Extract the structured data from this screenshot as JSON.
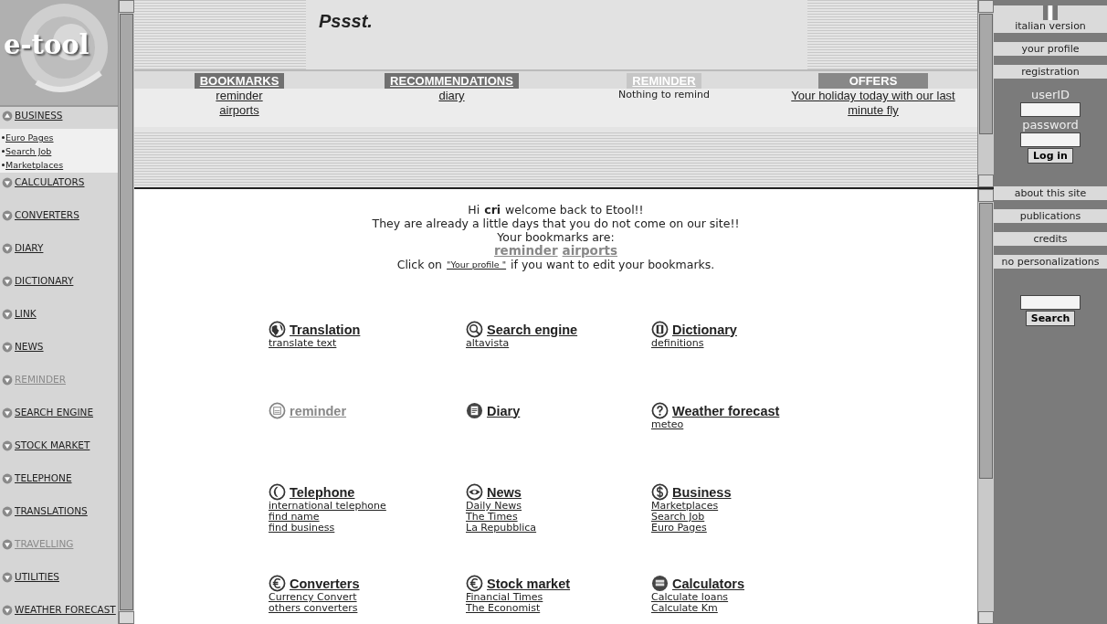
{
  "logo": {
    "text": "e-tool"
  },
  "sidebar": {
    "items": [
      {
        "label": "BUSINESS",
        "expanded": true,
        "disabled": false,
        "children": [
          {
            "label": "Euro Pages"
          },
          {
            "label": "Search Job"
          },
          {
            "label": "Marketplaces"
          }
        ]
      },
      {
        "label": "CALCULATORS",
        "expanded": false,
        "disabled": false
      },
      {
        "label": "CONVERTERS",
        "expanded": false,
        "disabled": false
      },
      {
        "label": "DIARY",
        "expanded": false,
        "disabled": false
      },
      {
        "label": "DICTIONARY",
        "expanded": false,
        "disabled": false
      },
      {
        "label": "LINK",
        "expanded": false,
        "disabled": false
      },
      {
        "label": "NEWS",
        "expanded": false,
        "disabled": false
      },
      {
        "label": "REMINDER",
        "expanded": false,
        "disabled": true
      },
      {
        "label": "SEARCH ENGINE",
        "expanded": false,
        "disabled": false
      },
      {
        "label": "STOCK MARKET",
        "expanded": false,
        "disabled": false
      },
      {
        "label": "TELEPHONE",
        "expanded": false,
        "disabled": false
      },
      {
        "label": "TRANSLATIONS",
        "expanded": false,
        "disabled": false
      },
      {
        "label": "TRAVELLING",
        "expanded": false,
        "disabled": true
      },
      {
        "label": "UTILITIES",
        "expanded": false,
        "disabled": false
      },
      {
        "label": "WEATHER FORECAST",
        "expanded": false,
        "disabled": false
      }
    ]
  },
  "banner": {
    "title": "Pssst."
  },
  "panels": [
    {
      "heading": "BOOKMARKS",
      "disabled": false,
      "links": [
        "reminder",
        "airports"
      ]
    },
    {
      "heading": "RECOMMENDATIONS",
      "disabled": false,
      "links": [
        "diary"
      ]
    },
    {
      "heading": "REMINDER",
      "disabled": true,
      "note": "Nothing to remind"
    },
    {
      "heading": "OFFERS",
      "disabled": false,
      "links": [
        "Your holiday today with our last minute fly"
      ]
    }
  ],
  "welcome": {
    "greeting": "Hi **cri** welcome back to Etool!!",
    "line_2": "They are already a little days that you do not come on our site!!",
    "line_3": "Your bookmarks are:",
    "bookmarks": [
      "reminder",
      "airports"
    ],
    "profile_prefix": "Click on",
    "profile_link": "\"Your profile \"",
    "profile_suffix": "if you want to edit your bookmarks."
  },
  "services": [
    {
      "title": "Translation",
      "disabled": false,
      "links": [
        "translate text"
      ]
    },
    {
      "title": "Search engine",
      "disabled": false,
      "links": [
        "altavista"
      ]
    },
    {
      "title": "Dictionary",
      "disabled": false,
      "links": [
        "definitions"
      ]
    },
    {
      "title": "reminder",
      "disabled": true
    },
    {
      "title": "Diary",
      "disabled": false
    },
    {
      "title": "Weather forecast",
      "disabled": false,
      "links": [
        "meteo"
      ]
    },
    {
      "title": "Telephone",
      "disabled": false,
      "links": [
        "international telephone",
        "find name",
        "find business"
      ]
    },
    {
      "title": "News",
      "disabled": false,
      "links": [
        "Daily News",
        "The Times",
        "La Repubblica"
      ]
    },
    {
      "title": "Business",
      "disabled": false,
      "links": [
        "Marketplaces",
        "Search Job",
        "Euro Pages"
      ]
    },
    {
      "title": "Converters",
      "disabled": false,
      "links": [
        "Currency Convert",
        "others converters"
      ]
    },
    {
      "title": "Stock market",
      "disabled": false,
      "links": [
        "Financial Times",
        "The Economist"
      ]
    },
    {
      "title": "Calculators",
      "disabled": false,
      "links": [
        "Calculate loans",
        "Calculate Km"
      ]
    }
  ],
  "right_menu": {
    "top_buttons": [
      "italian version",
      "your profile",
      "registration"
    ],
    "login": {
      "user_label": "userID",
      "password_label": "password",
      "button": "Log in"
    },
    "bottom_buttons": [
      "about this site",
      "publications",
      "credits",
      "no personalizations"
    ],
    "search_button": "Search"
  }
}
